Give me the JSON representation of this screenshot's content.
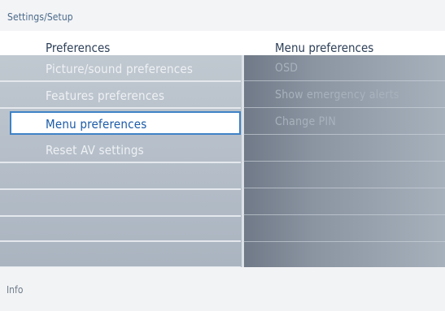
{
  "breadcrumb": "Settings/Setup",
  "header": {
    "left_title": "Preferences",
    "right_title": "Menu preferences"
  },
  "left_menu": {
    "items": [
      {
        "label": "Picture/sound preferences",
        "selected": false
      },
      {
        "label": "Features preferences",
        "selected": false
      },
      {
        "label": "Menu preferences",
        "selected": true
      },
      {
        "label": "Reset AV settings",
        "selected": false
      },
      {
        "label": "",
        "selected": false
      },
      {
        "label": "",
        "selected": false
      },
      {
        "label": "",
        "selected": false
      },
      {
        "label": "",
        "selected": false
      }
    ]
  },
  "right_menu": {
    "items": [
      {
        "label": "OSD"
      },
      {
        "label": "Show emergency alerts"
      },
      {
        "label": "Change PIN"
      },
      {
        "label": ""
      },
      {
        "label": ""
      },
      {
        "label": ""
      },
      {
        "label": ""
      },
      {
        "label": ""
      }
    ]
  },
  "info": {
    "label": "Info"
  },
  "colors": {
    "selection_border": "#3f82c6",
    "selection_text": "#1a5aa8",
    "header_text": "#2e4058"
  }
}
